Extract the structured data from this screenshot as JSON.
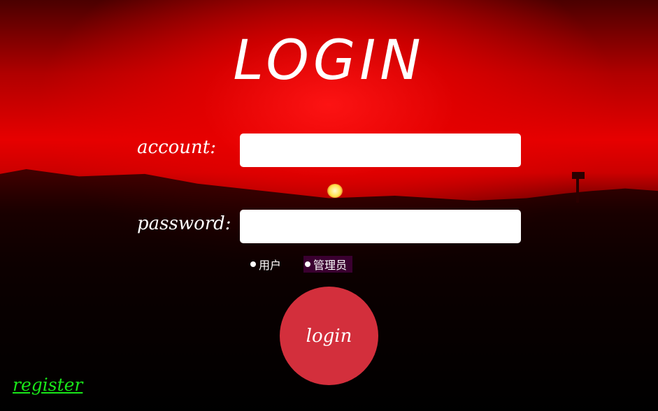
{
  "page": {
    "title": "LOGIN"
  },
  "form": {
    "account_label": "account:",
    "account_value": "",
    "password_label": "password:",
    "password_value": "",
    "roles": [
      {
        "label": "用户"
      },
      {
        "label": "管理员"
      }
    ],
    "login_label": "login"
  },
  "links": {
    "register_label": "register"
  },
  "colors": {
    "login_button": "#d32f3c",
    "register_link": "#19e619",
    "background_accent": "#e60000"
  }
}
